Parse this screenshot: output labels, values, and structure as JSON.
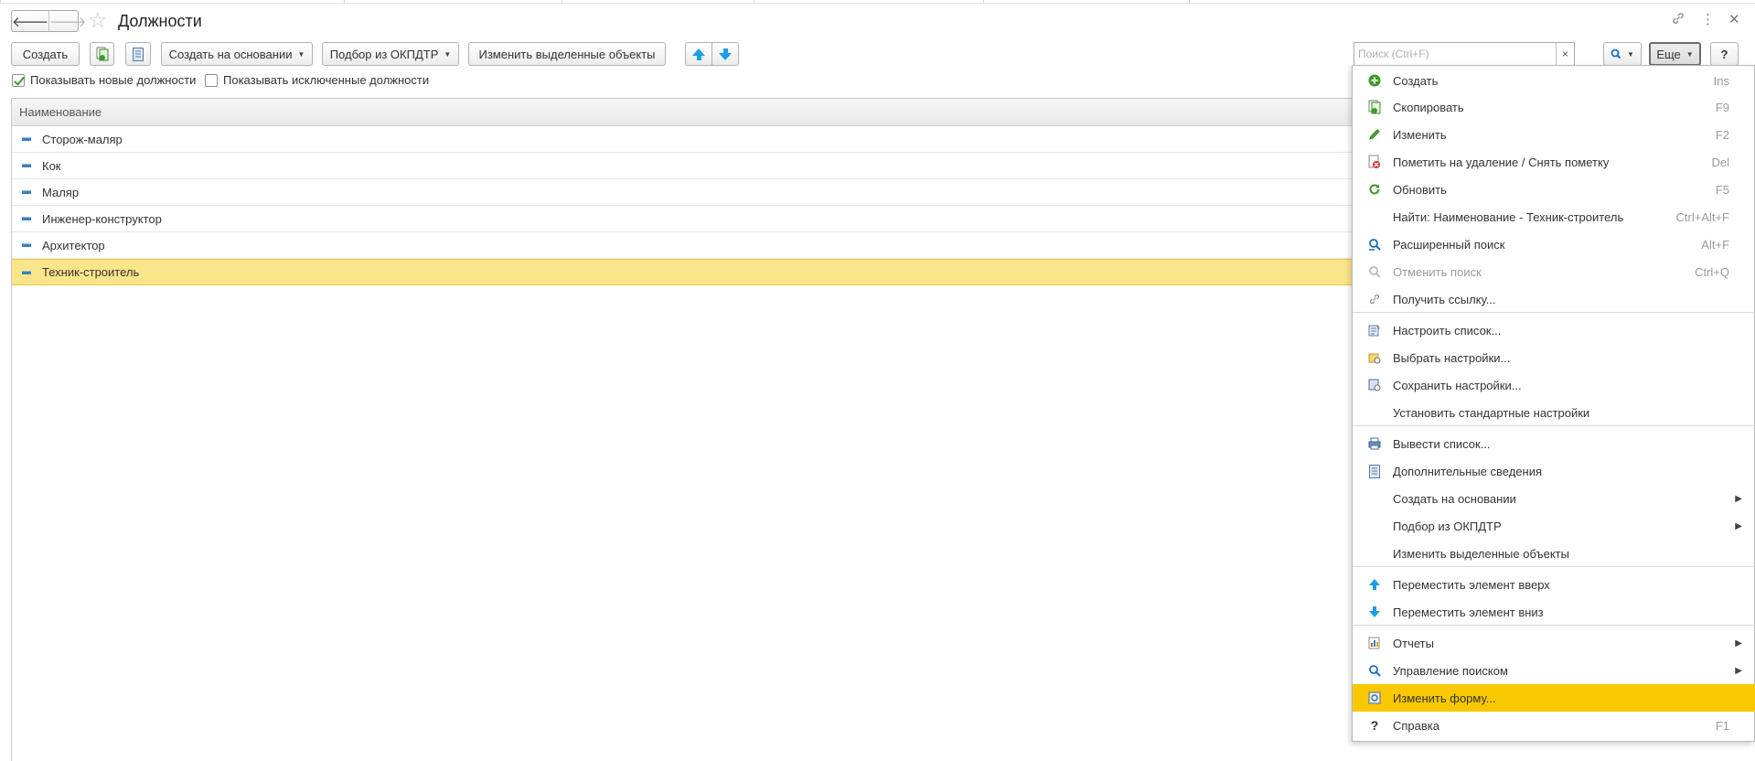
{
  "window": {
    "title": "Должности"
  },
  "toolbar": {
    "create": "Создать",
    "create_based_on": "Создать на основании",
    "okpdtr_selection": "Подбор из ОКПДТР",
    "change_selected": "Изменить выделенные объекты",
    "search_placeholder": "Поиск (Ctrl+F)",
    "search_clear": "×",
    "more": "Еще",
    "help": "?"
  },
  "filters": {
    "show_new": "Показывать новые должности",
    "show_new_checked": true,
    "show_excluded": "Показывать исключенные должности",
    "show_excluded_checked": false
  },
  "list": {
    "column_header": "Наименование",
    "rows": [
      "Сторож-маляр",
      "Кок",
      "Маляр",
      "Инженер-конструктор",
      "Архитектор",
      "Техник-строитель"
    ],
    "selected_row": "Техник-строитель"
  },
  "menu": {
    "items": [
      {
        "label": "Создать",
        "shortcut": "Ins",
        "icon": "plus-circle-icon"
      },
      {
        "label": "Скопировать",
        "shortcut": "F9",
        "icon": "copy-icon"
      },
      {
        "label": "Изменить",
        "shortcut": "F2",
        "icon": "pencil-icon"
      },
      {
        "label": "Пометить на удаление / Снять пометку",
        "shortcut": "Del",
        "icon": "delete-mark-icon"
      },
      {
        "label": "Обновить",
        "shortcut": "F5",
        "icon": "refresh-icon"
      },
      {
        "label": "Найти: Наименование - Техник-строитель",
        "shortcut": "Ctrl+Alt+F",
        "icon": ""
      },
      {
        "label": "Расширенный поиск",
        "shortcut": "Alt+F",
        "icon": "advanced-search-icon"
      },
      {
        "label": "Отменить поиск",
        "shortcut": "Ctrl+Q",
        "icon": "cancel-search-icon"
      },
      {
        "label": "Получить ссылку...",
        "shortcut": "",
        "icon": "link-icon"
      },
      {
        "label": "Настроить список...",
        "shortcut": "",
        "icon": "list-settings-icon"
      },
      {
        "label": "Выбрать настройки...",
        "shortcut": "",
        "icon": "load-settings-icon"
      },
      {
        "label": "Сохранить настройки...",
        "shortcut": "",
        "icon": "save-settings-icon"
      },
      {
        "label": "Установить стандартные настройки",
        "shortcut": "",
        "icon": ""
      },
      {
        "label": "Вывести список...",
        "shortcut": "",
        "icon": "print-list-icon"
      },
      {
        "label": "Дополнительные сведения",
        "shortcut": "",
        "icon": "document-icon"
      },
      {
        "label": "Создать на основании",
        "shortcut": "",
        "icon": ""
      },
      {
        "label": "Подбор из ОКПДТР",
        "shortcut": "",
        "icon": ""
      },
      {
        "label": "Изменить выделенные объекты",
        "shortcut": "",
        "icon": ""
      },
      {
        "label": "Переместить элемент вверх",
        "shortcut": "",
        "icon": "arrow-up-icon"
      },
      {
        "label": "Переместить элемент вниз",
        "shortcut": "",
        "icon": "arrow-down-icon"
      },
      {
        "label": "Отчеты",
        "shortcut": "",
        "icon": "reports-icon"
      },
      {
        "label": "Управление поиском",
        "shortcut": "",
        "icon": "search-icon"
      },
      {
        "label": "Изменить форму...",
        "shortcut": "",
        "icon": "form-settings-icon"
      },
      {
        "label": "Справка",
        "shortcut": "F1",
        "icon": "help-icon"
      }
    ]
  },
  "colors": {
    "selected_row": "#fbe58b",
    "menu_highlight": "#f9c800",
    "accent_blue": "#1b9ee4",
    "accent_green": "#3a9d23"
  }
}
